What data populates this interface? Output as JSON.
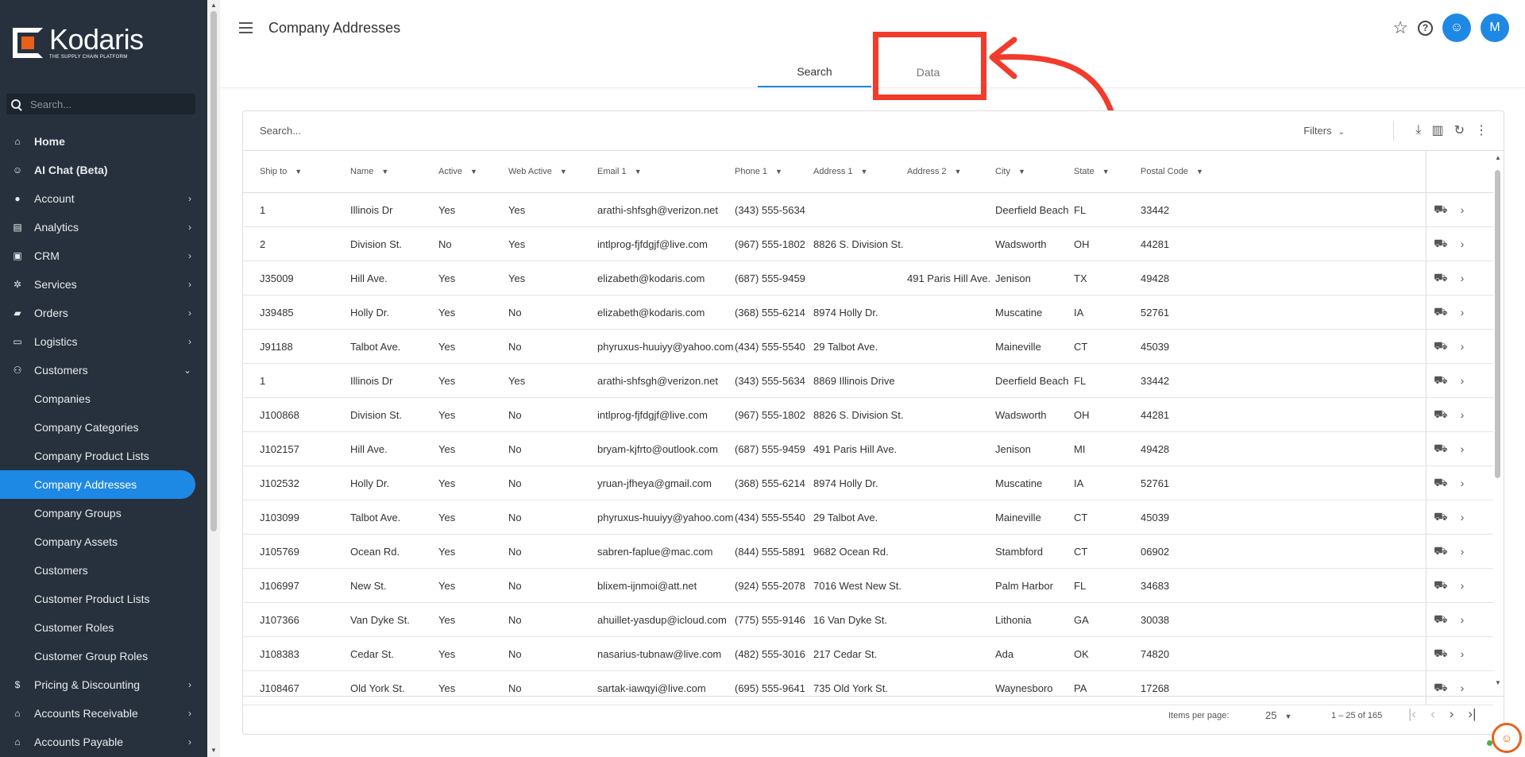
{
  "sidebar": {
    "brand": "Kodaris",
    "tagline": "THE SUPPLY CHAIN PLATFORM",
    "search_placeholder": "Search...",
    "items": [
      {
        "label": "Home",
        "icon": "home-icon"
      },
      {
        "label": "AI Chat (Beta)",
        "icon": "robot-icon"
      },
      {
        "label": "Account",
        "icon": "person-icon"
      },
      {
        "label": "Analytics",
        "icon": "analytics-icon"
      },
      {
        "label": "CRM",
        "icon": "crm-icon"
      },
      {
        "label": "Services",
        "icon": "services-icon"
      },
      {
        "label": "Orders",
        "icon": "truck-icon"
      },
      {
        "label": "Logistics",
        "icon": "logistics-icon"
      },
      {
        "label": "Customers",
        "icon": "people-icon"
      }
    ],
    "sub_items": [
      "Companies",
      "Company Categories",
      "Company Product Lists",
      "Company Addresses",
      "Company Groups",
      "Company Assets",
      "Customers",
      "Customer Product Lists",
      "Customer Roles",
      "Customer Group Roles"
    ],
    "bottom_items": [
      {
        "label": "Pricing & Discounting",
        "icon": "dollar-icon"
      },
      {
        "label": "Accounts Receivable",
        "icon": "bank-icon"
      },
      {
        "label": "Accounts Payable",
        "icon": "bank-icon"
      }
    ]
  },
  "header": {
    "title": "Company Addresses",
    "avatar_initial": "M"
  },
  "tabs": [
    "Search",
    "Data"
  ],
  "table": {
    "search_placeholder": "Search...",
    "filters_label": "Filters",
    "columns": [
      "Ship to",
      "Name",
      "Active",
      "Web Active",
      "Email 1",
      "Phone 1",
      "Address 1",
      "Address 2",
      "City",
      "State",
      "Postal Code"
    ],
    "rows": [
      [
        "1",
        "Illinois Dr",
        "Yes",
        "Yes",
        "arathi-shfsgh@verizon.net",
        "(343) 555-5634",
        "",
        "",
        "Deerfield Beach",
        "FL",
        "33442"
      ],
      [
        "2",
        "Division St.",
        "No",
        "Yes",
        "intlprog-fjfdgjf@live.com",
        "(967) 555-1802",
        "8826 S. Division St.",
        "",
        "Wadsworth",
        "OH",
        "44281"
      ],
      [
        "J35009",
        "Hill Ave.",
        "Yes",
        "Yes",
        "elizabeth@kodaris.com",
        "(687) 555-9459",
        "",
        "491 Paris Hill Ave.",
        "Jenison",
        "TX",
        "49428"
      ],
      [
        "J39485",
        "Holly Dr.",
        "Yes",
        "No",
        "elizabeth@kodaris.com",
        "(368) 555-6214",
        "8974 Holly Dr.",
        "",
        "Muscatine",
        "IA",
        "52761"
      ],
      [
        "J91188",
        "Talbot Ave.",
        "Yes",
        "No",
        "phyruxus-huuiyy@yahoo.com",
        "(434) 555-5540",
        "29 Talbot Ave.",
        "",
        "Maineville",
        "CT",
        "45039"
      ],
      [
        "1",
        "Illinois Dr",
        "Yes",
        "Yes",
        "arathi-shfsgh@verizon.net",
        "(343) 555-5634",
        "8869 Illinois Drive",
        "",
        "Deerfield Beach",
        "FL",
        "33442"
      ],
      [
        "J100868",
        "Division St.",
        "Yes",
        "No",
        "intlprog-fjfdgjf@live.com",
        "(967) 555-1802",
        "8826 S. Division St.",
        "",
        "Wadsworth",
        "OH",
        "44281"
      ],
      [
        "J102157",
        "Hill Ave.",
        "Yes",
        "No",
        "bryam-kjfrto@outlook.com",
        "(687) 555-9459",
        "491 Paris Hill Ave.",
        "",
        "Jenison",
        "MI",
        "49428"
      ],
      [
        "J102532",
        "Holly Dr.",
        "Yes",
        "No",
        "yruan-jfheya@gmail.com",
        "(368) 555-6214",
        "8974 Holly Dr.",
        "",
        "Muscatine",
        "IA",
        "52761"
      ],
      [
        "J103099",
        "Talbot Ave.",
        "Yes",
        "No",
        "phyruxus-huuiyy@yahoo.com",
        "(434) 555-5540",
        "29 Talbot Ave.",
        "",
        "Maineville",
        "CT",
        "45039"
      ],
      [
        "J105769",
        "Ocean Rd.",
        "Yes",
        "No",
        "sabren-faplue@mac.com",
        "(844) 555-5891",
        "9682 Ocean Rd.",
        "",
        "Stambford",
        "CT",
        "06902"
      ],
      [
        "J106997",
        "New St.",
        "Yes",
        "No",
        "blixem-ijnmoi@att.net",
        "(924) 555-2078",
        "7016 West New St.",
        "",
        "Palm Harbor",
        "FL",
        "34683"
      ],
      [
        "J107366",
        "Van Dyke St.",
        "Yes",
        "No",
        "ahuillet-yasdup@icloud.com",
        "(775) 555-9146",
        "16 Van Dyke St.",
        "",
        "Lithonia",
        "GA",
        "30038"
      ],
      [
        "J108383",
        "Cedar St.",
        "Yes",
        "No",
        "nasarius-tubnaw@live.com",
        "(482) 555-3016",
        "217 Cedar St.",
        "",
        "Ada",
        "OK",
        "74820"
      ],
      [
        "J108467",
        "Old York St.",
        "Yes",
        "No",
        "sartak-iawqyi@live.com",
        "(695) 555-9641",
        "735 Old York St.",
        "",
        "Waynesboro",
        "PA",
        "17268"
      ]
    ]
  },
  "paginator": {
    "label": "Items per page:",
    "size": "25",
    "range": "1 – 25 of 165"
  },
  "colors": {
    "sidebar_bg": "#27313d",
    "accent": "#1e88e5",
    "highlight": "#f23b2b",
    "brand_orange": "#e8601c"
  }
}
